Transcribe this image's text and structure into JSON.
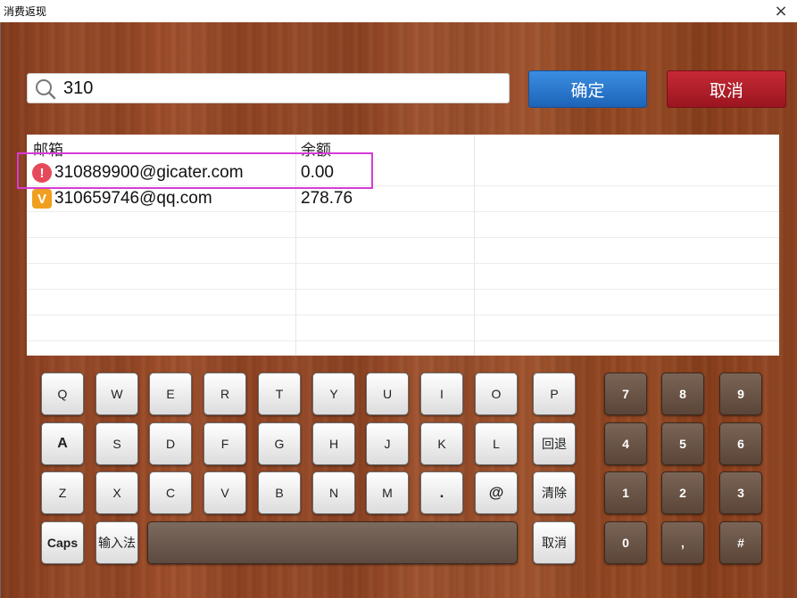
{
  "window": {
    "title": "消费返现",
    "close": "×"
  },
  "search": {
    "value": "310"
  },
  "actions": {
    "confirm": "确定",
    "cancel": "取消"
  },
  "table": {
    "headers": {
      "email": "邮箱",
      "balance": "余额"
    },
    "rows": [
      {
        "icon": "!",
        "email": "310889900@gicater.com",
        "balance": "0.00"
      },
      {
        "icon": "V",
        "email": "310659746@qq.com",
        "balance": "278.76"
      }
    ]
  },
  "keyboard": {
    "row1": [
      "Q",
      "W",
      "E",
      "R",
      "T",
      "Y",
      "U",
      "I",
      "O",
      "P"
    ],
    "row2": [
      "A",
      "S",
      "D",
      "F",
      "G",
      "H",
      "J",
      "K",
      "L",
      "回退"
    ],
    "row3": [
      "Z",
      "X",
      "C",
      "V",
      "B",
      "N",
      "M",
      ".",
      "@",
      "清除"
    ],
    "row4": {
      "caps": "Caps",
      "ime": "输入法",
      "cancel": "取消"
    },
    "numpad": [
      "7",
      "8",
      "9",
      "4",
      "5",
      "6",
      "1",
      "2",
      "3",
      "0",
      ",",
      "#"
    ]
  }
}
